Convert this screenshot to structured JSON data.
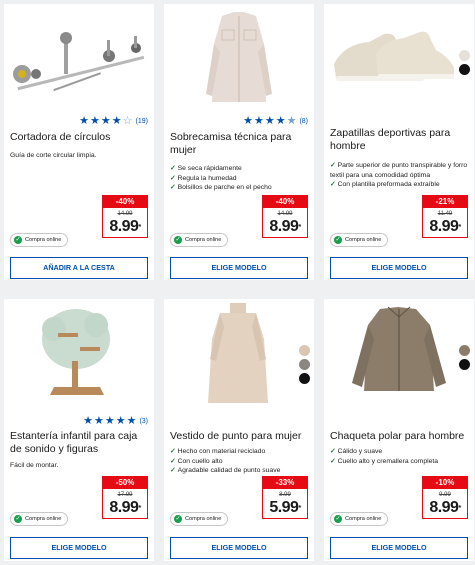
{
  "colors": {
    "accent": "#0050aa",
    "sale": "#e60a14",
    "online": "#1b9e4b"
  },
  "products": [
    {
      "title": "Cortadora de círculos",
      "rating": 4,
      "rating_count": "(19)",
      "description": "Guía de corte circular limpia.",
      "discount": "-40%",
      "old_price": "14.99",
      "price": "8.99",
      "asterisk": "*",
      "badge": "Compra online",
      "button": "AÑADIR A LA CESTA",
      "swatches": []
    },
    {
      "title": "Sobrecamisa técnica para mujer",
      "rating": 4.5,
      "rating_count": "(8)",
      "bullets": [
        "Se seca rápidamente",
        "Regula la humedad",
        "Bolsillos de parche en el pecho"
      ],
      "discount": "-40%",
      "old_price": "14.99",
      "price": "8.99",
      "asterisk": "*",
      "badge": "Compra online",
      "button": "ELIGE MODELO",
      "swatches": []
    },
    {
      "title": "Zapatillas deportivas para hombre",
      "bullets": [
        "Parte superior de punto transpirable y forro textil para una comodidad óptima",
        "Con plantilla preformada extraíble"
      ],
      "discount": "-21%",
      "old_price": "11.49",
      "price": "8.99",
      "asterisk": "*",
      "badge": "Compra online",
      "button": "ELIGE MODELO",
      "swatches": [
        "#e6e1d8",
        "#111111"
      ]
    },
    {
      "title": "Estantería infantil para caja de sonido y figuras",
      "rating": 5,
      "rating_count": "(3)",
      "description": "Fácil de montar.",
      "discount": "-50%",
      "old_price": "17.99",
      "price": "8.99",
      "asterisk": "*",
      "badge": "Compra online",
      "button": "ELIGE MODELO",
      "swatches": []
    },
    {
      "title": "Vestido de punto para mujer",
      "bullets": [
        "Hecho con material reciclado",
        "Con cuello alto",
        "Agradable calidad de punto suave"
      ],
      "discount": "-33%",
      "old_price": "8.99",
      "price": "5.99",
      "asterisk": "*",
      "badge": "Compra online",
      "button": "ELIGE MODELO",
      "swatches": [
        "#d9c7b4",
        "#8a8680",
        "#111111"
      ]
    },
    {
      "title": "Chaqueta polar para hombre",
      "bullets": [
        "Cálido y suave",
        "Cuello alto y cremallera completa"
      ],
      "discount": "-10%",
      "old_price": "9.99",
      "price": "8.99",
      "asterisk": "*",
      "badge": "Compra online",
      "button": "ELIGE MODELO",
      "swatches": [
        "#8b7d6a",
        "#111111"
      ]
    }
  ]
}
